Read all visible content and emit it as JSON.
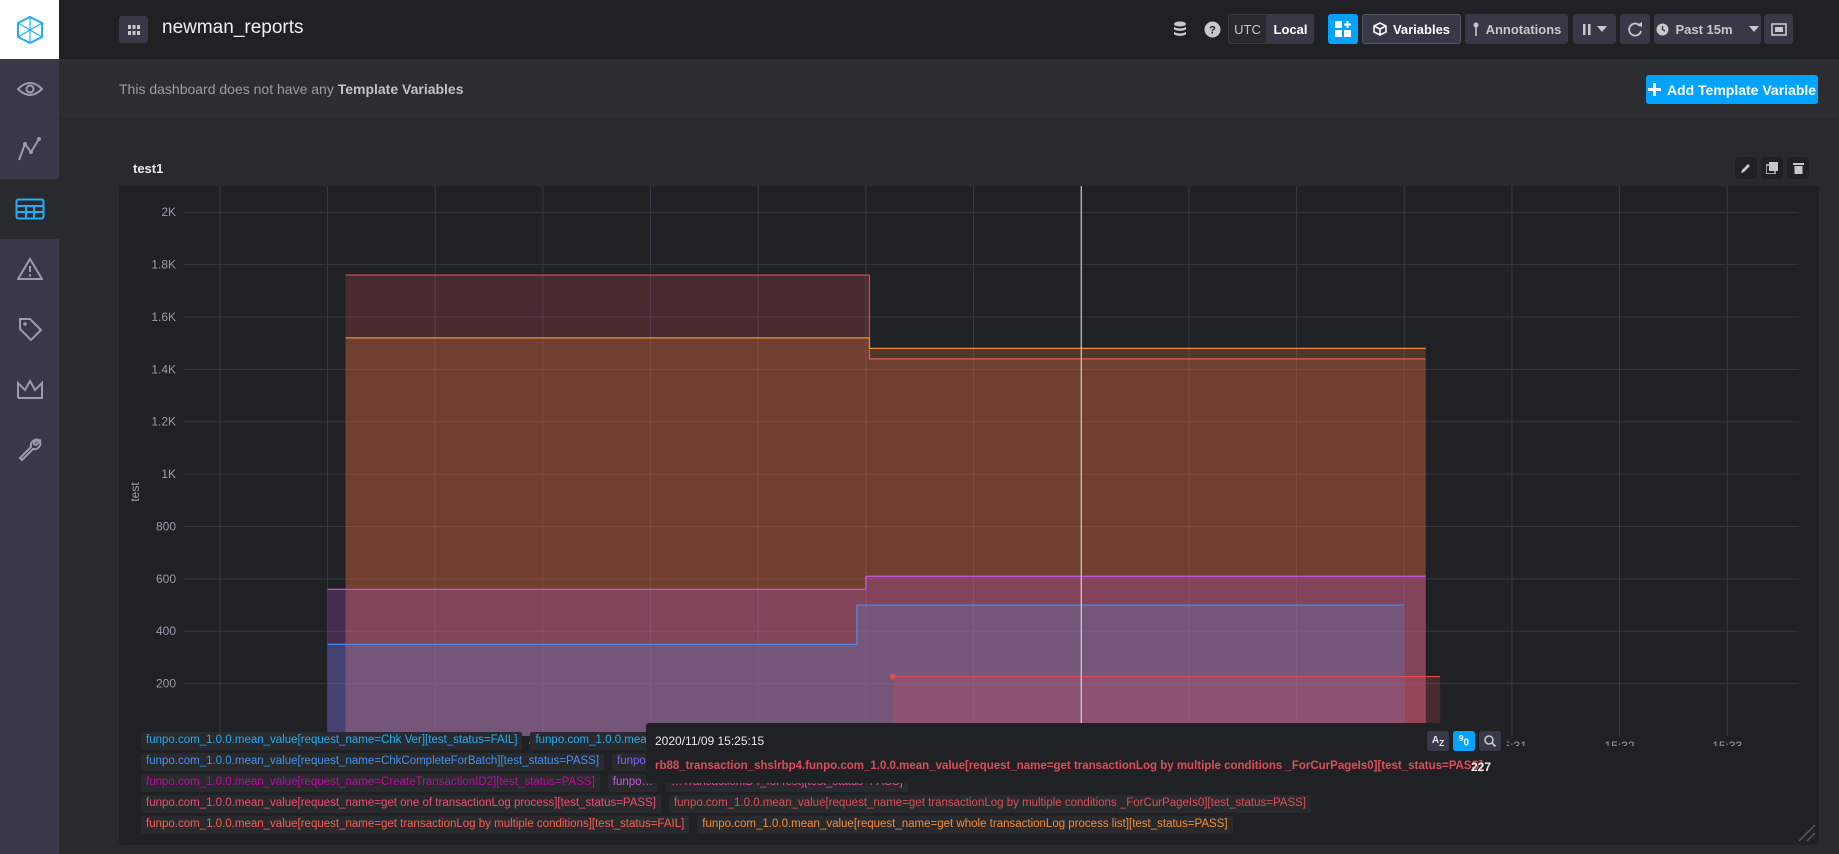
{
  "app": {
    "dashboard_name": "newman_reports"
  },
  "sidebar": {
    "items": [
      {
        "name": "logo-icon"
      },
      {
        "name": "eye-icon"
      },
      {
        "name": "graph-icon"
      },
      {
        "name": "dashboards-icon",
        "active": true
      },
      {
        "name": "alert-icon"
      },
      {
        "name": "tag-icon"
      },
      {
        "name": "crown-icon"
      },
      {
        "name": "wrench-icon"
      }
    ]
  },
  "toolbar": {
    "utc_label": "UTC",
    "local_label": "Local",
    "variables_label": "Variables",
    "annotations_label": "Annotations",
    "time_range_label": "Past 15m"
  },
  "template_bar": {
    "text_prefix": "This dashboard does not have any",
    "text_bold": "Template Variables",
    "add_button_label": "Add Template Variable"
  },
  "cell": {
    "title": "test1"
  },
  "chart_data": {
    "type": "line",
    "ylabel": "test",
    "ylim": [
      0,
      2100
    ],
    "y_ticks": [
      "200",
      "400",
      "600",
      "800",
      "1K",
      "1.2K",
      "1.4K",
      "1.6K",
      "1.8K",
      "2K"
    ],
    "x_ticks": [
      "15:19",
      "15:20",
      "15:21",
      "15:22",
      "15:23",
      "15:24",
      "15:25",
      "15:26",
      "15:27",
      "15:28",
      "15:29",
      "15:30",
      "15:31",
      "15:32",
      "15:33"
    ],
    "series": [
      {
        "color": "#dc4e58",
        "points": [
          [
            "15:20:10",
            1760
          ],
          [
            "15:25:02",
            1760
          ],
          [
            "15:25:02",
            1440
          ],
          [
            "15:30:12",
            1440
          ]
        ]
      },
      {
        "color": "#f48d38",
        "points": [
          [
            "15:20:10",
            1520
          ],
          [
            "15:25:02",
            1520
          ],
          [
            "15:25:02",
            1480
          ],
          [
            "15:30:12",
            1480
          ]
        ]
      },
      {
        "color": "#ce58eb",
        "points": [
          [
            "15:20:00",
            560
          ],
          [
            "15:25:00",
            560
          ],
          [
            "15:25:00",
            610
          ],
          [
            "15:30:12",
            610
          ]
        ]
      },
      {
        "color": "#4591ed",
        "points": [
          [
            "15:20:00",
            350
          ],
          [
            "15:24:55",
            350
          ],
          [
            "15:24:55",
            500
          ],
          [
            "15:30:00",
            500
          ]
        ]
      },
      {
        "color": "#dc4e58",
        "points": [
          [
            "15:25:15",
            227
          ],
          [
            "15:30:20",
            227
          ]
        ]
      }
    ],
    "hover_time": "15:27"
  },
  "legend": {
    "rows": [
      [
        {
          "text": "funpo.com_1.0.0.mean_value[request_name=Chk Ver][test_status=FAIL]",
          "color": "#22adf6"
        },
        {
          "text": "funpo.com_1.0.0.mean_value[request_name=Chk…",
          "color": "#22adf6"
        },
        {
          "text": "…equest_status=PASS]",
          "color": "#4591ed"
        }
      ],
      [
        {
          "text": "funpo.com_1.0.0.mean_value[request_name=ChkCompleteForBatch][test_status=PASS]",
          "color": "#4591ed"
        },
        {
          "text": "funpo.com…",
          "color": "#7a65f2"
        },
        {
          "text": "…][test_status=PASS]",
          "color": "#9394ff"
        }
      ],
      [
        {
          "text": "funpo.com_1.0.0.mean_value[request_name=CreateTransactionID2][test_status=PASS]",
          "color": "#bf09a5"
        },
        {
          "text": "funpo…",
          "color": "#ce58eb"
        },
        {
          "text": "…TransactionID4_forTest][test_status=PASS]",
          "color": "#e9499e"
        }
      ],
      [
        {
          "text": "funpo.com_1.0.0.mean_value[request_name=get one of transactionLog process][test_status=PASS]",
          "color": "#f04c74"
        },
        {
          "text": "funpo.com_1.0.0.mean_value[request_name=get transactionLog by multiple conditions _ForCurPageIs0][test_status=PASS]",
          "color": "#dc4e58"
        }
      ],
      [
        {
          "text": "funpo.com_1.0.0.mean_value[request_name=get transactionLog by multiple conditions][test_status=FAIL]",
          "color": "#f95f53"
        },
        {
          "text": "funpo.com_1.0.0.mean_value[request_name=get whole transactionLog process list][test_status=PASS]",
          "color": "#f48d38"
        }
      ]
    ]
  },
  "tooltip": {
    "time": "2020/11/09 15:25:15",
    "series_name": "rb88_transaction_shslrbp4.funpo.com_1.0.0.mean_value[request_name=get transactionLog by multiple conditions _ForCurPageIs0][test_status=PASS]",
    "value": "227"
  }
}
